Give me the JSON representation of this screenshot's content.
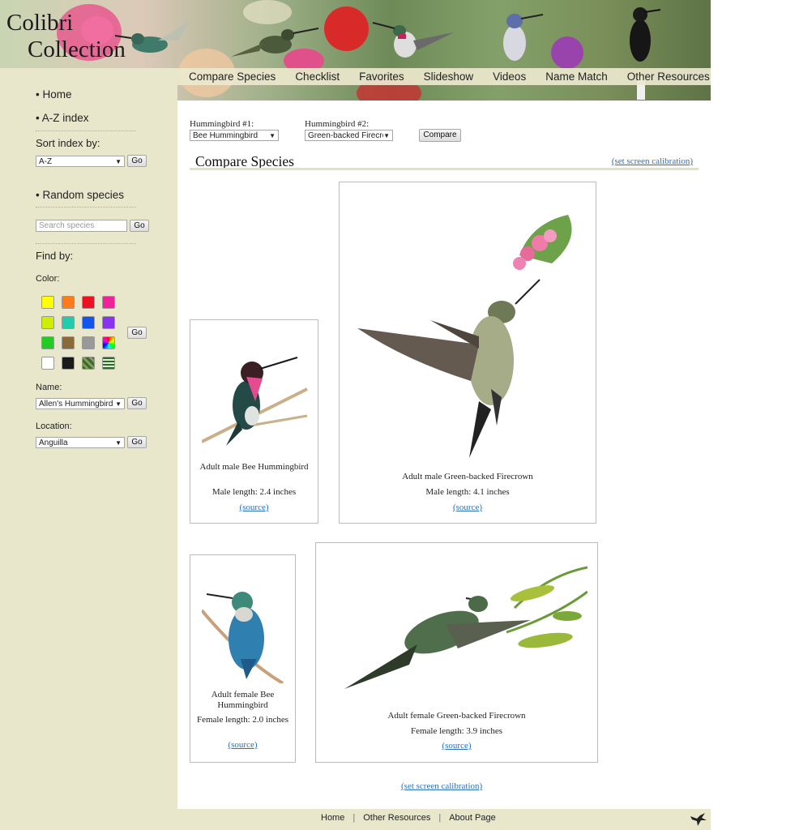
{
  "brand": {
    "line1": "Colibri",
    "line2": "Collection"
  },
  "nav": [
    "Compare Species",
    "Checklist",
    "Favorites",
    "Slideshow",
    "Videos",
    "Name Match",
    "Other Resources"
  ],
  "sidebar": {
    "home": "• Home",
    "az_index": "• A-Z index",
    "sort_label": "Sort index by:",
    "sort_value": "A-Z",
    "go": "Go",
    "random": "• Random species",
    "search_placeholder": "Search species",
    "find_by": "Find by:",
    "color_label": "Color:",
    "colors": [
      "#ffff00",
      "#ff7a1a",
      "#ee1122",
      "#ee2299",
      "#ccee00",
      "#22ccaa",
      "#1155ee",
      "#8833ee",
      "#22cc22",
      "#8a6a3a",
      "#999999",
      "rainbow",
      "#ffffff",
      "#1a1a1a",
      "pattern-green",
      "pattern-stripes"
    ],
    "name_label": "Name:",
    "name_value": "Allen's Hummingbird",
    "location_label": "Location:",
    "location_value": "Anguilla"
  },
  "compare": {
    "hb1_label": "Hummingbird #1:",
    "hb1_value": "Bee Hummingbird",
    "hb2_label": "Hummingbird #2:",
    "hb2_value": "Green-backed Firecro",
    "compare_button": "Compare",
    "title": "Compare Species",
    "calibration": "(set screen calibration)"
  },
  "cards": [
    {
      "caption": "Adult male Bee Hummingbird",
      "length": "Male length: 2.4 inches",
      "source": "(source)"
    },
    {
      "caption": "Adult male Green-backed Firecrown",
      "length": "Male length: 4.1 inches",
      "source": "(source)"
    },
    {
      "caption": "Adult female Bee Hummingbird",
      "length": "Female length: 2.0 inches",
      "source": "(source)"
    },
    {
      "caption": "Adult female Green-backed Firecrown",
      "length": "Female length: 3.9 inches",
      "source": "(source)"
    }
  ],
  "bottom_calibration": "(set screen calibration)",
  "footer": [
    "Home",
    "Other Resources",
    "About Page"
  ]
}
